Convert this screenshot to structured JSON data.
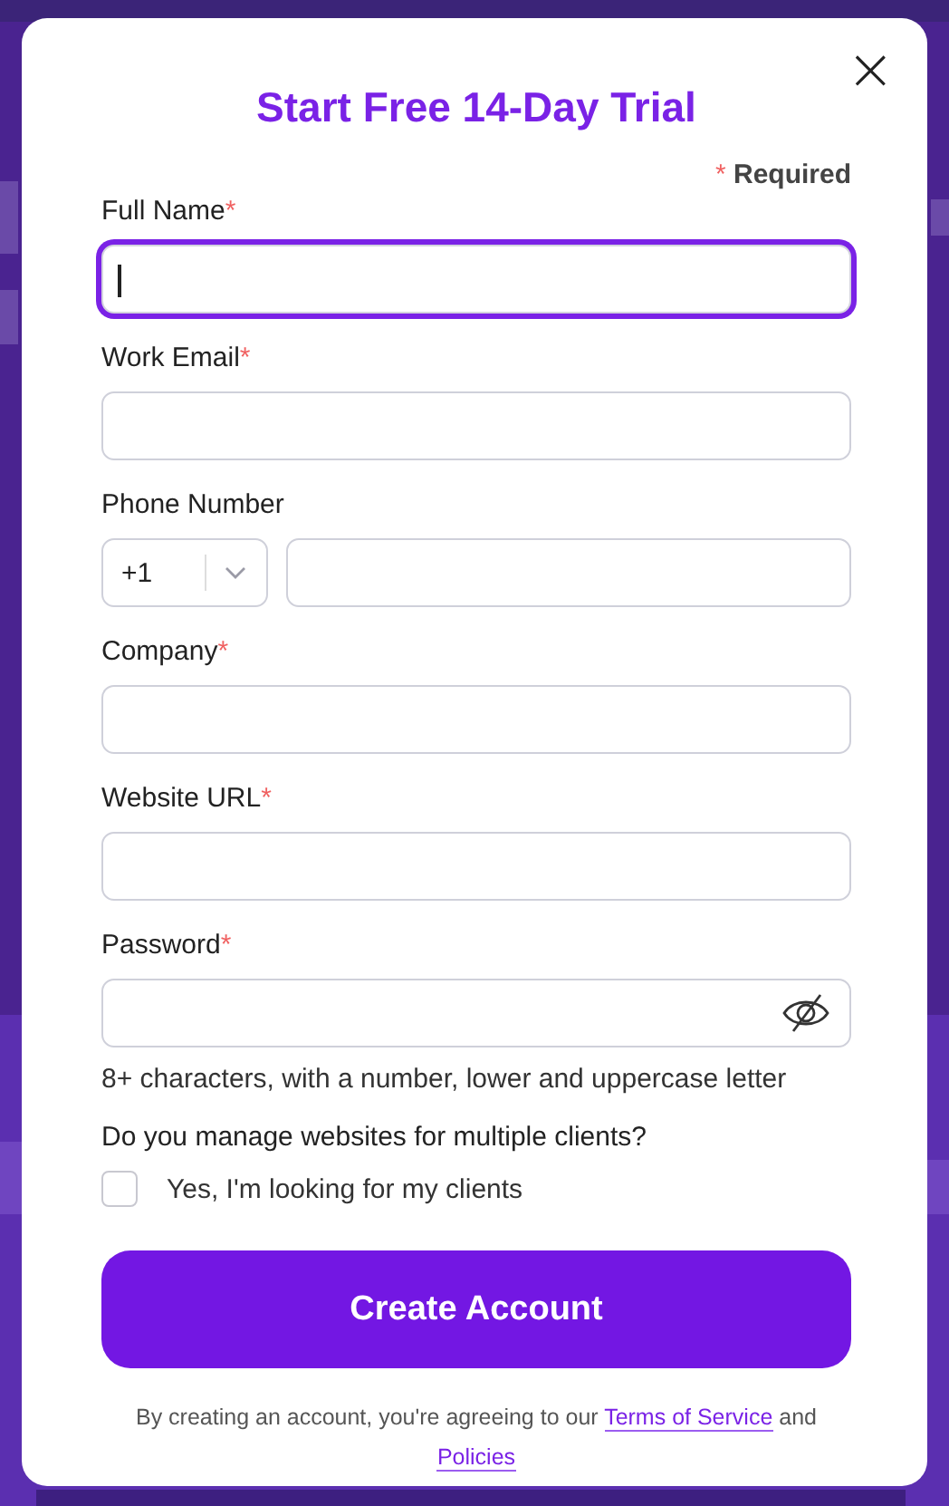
{
  "dialog": {
    "title": "Start Free 14-Day Trial",
    "close": "×",
    "required_note": {
      "mark": "*",
      "text": "Required"
    }
  },
  "fields": [
    {
      "kind": "text",
      "label": "Full Name",
      "required": true,
      "focused": true
    },
    {
      "kind": "text",
      "label": "Work Email",
      "required": true,
      "focused": false
    },
    {
      "kind": "phone",
      "label": "Phone Number",
      "required": false,
      "focused": false,
      "country_code": "+1"
    },
    {
      "kind": "text",
      "label": "Company",
      "required": true,
      "focused": false
    },
    {
      "kind": "text",
      "label": "Website URL",
      "required": true,
      "focused": false
    },
    {
      "kind": "password",
      "label": "Password",
      "required": true,
      "focused": false,
      "hint": "8+ characters, with a number, lower and uppercase letter"
    }
  ],
  "clients_question": {
    "label": "Do you manage websites for multiple clients?",
    "option": "Yes, I'm looking for my clients",
    "checked": false
  },
  "submit_button": "Create Account",
  "legal": {
    "before": "By creating an account, you're agreeing to our",
    "link_1": "Terms of Service",
    "middle": "and",
    "link_2": "Policies"
  }
}
